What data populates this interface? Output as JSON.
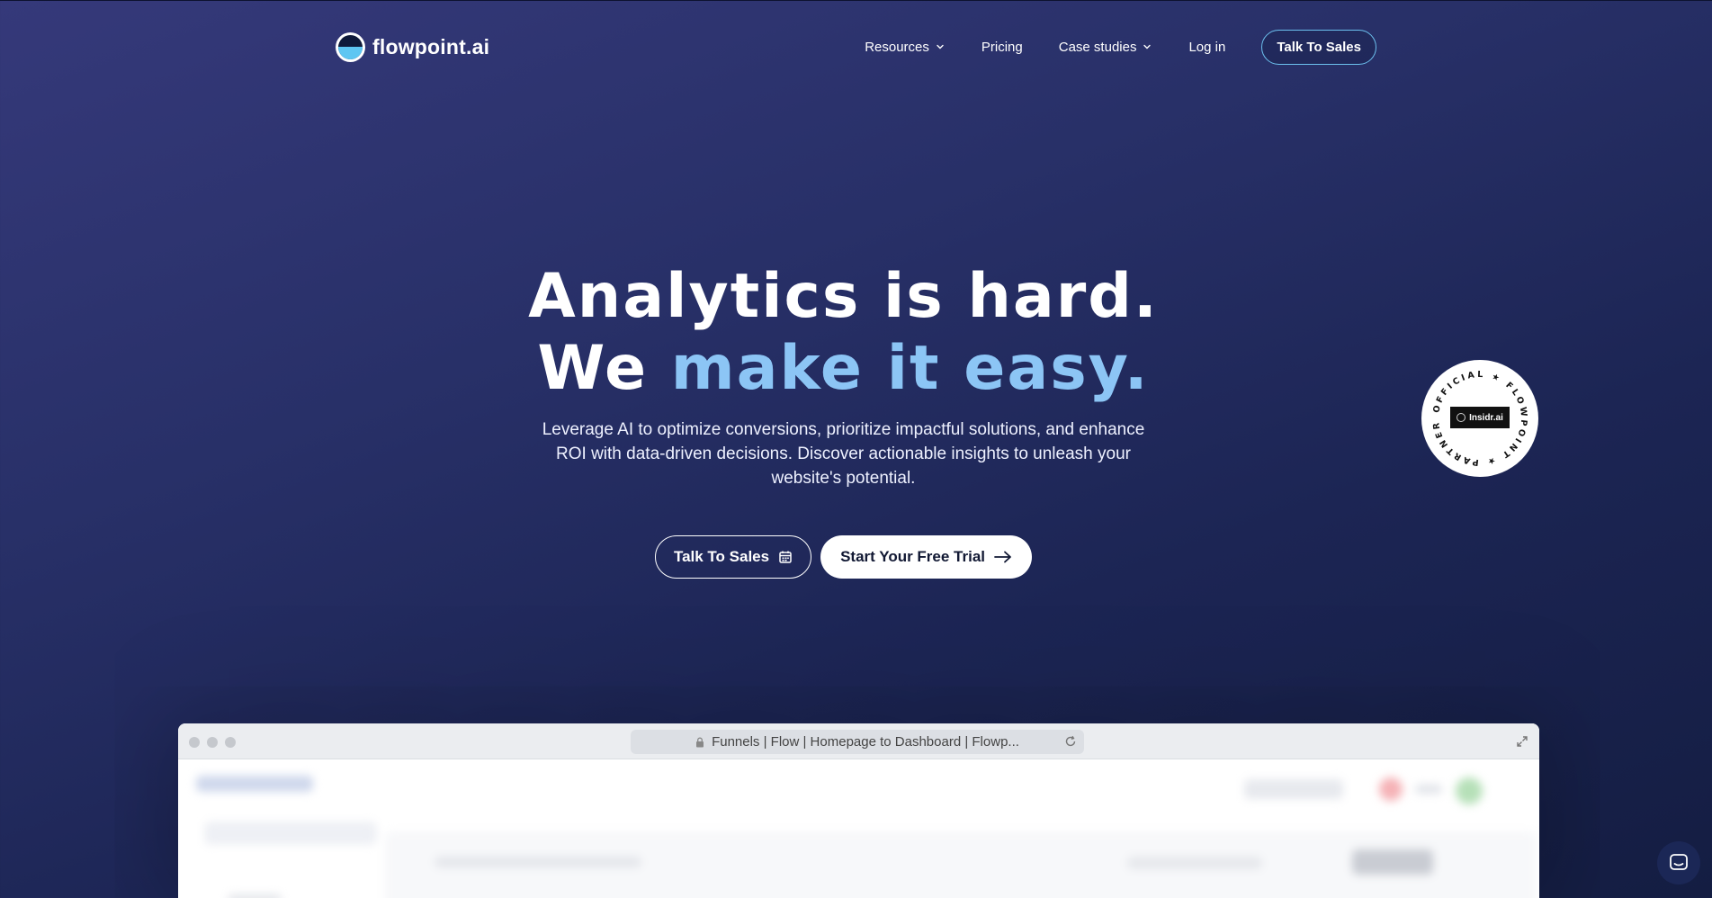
{
  "brand": {
    "name": "flowpoint.ai"
  },
  "nav": {
    "items": [
      {
        "label": "Resources",
        "dropdown": true
      },
      {
        "label": "Pricing",
        "dropdown": false
      },
      {
        "label": "Case studies",
        "dropdown": true
      },
      {
        "label": "Log in",
        "dropdown": false
      }
    ],
    "cta": "Talk To Sales"
  },
  "hero": {
    "line1": "Analytics is hard.",
    "line2_start": "We",
    "line2_accent": "make it",
    "line2_end": "easy.",
    "subtitle": "Leverage AI to optimize conversions, prioritize impactful solutions, and enhance ROI with data-driven decisions. Discover actionable insights to unleash your website's potential.",
    "cta_secondary": "Talk To Sales",
    "cta_primary": "Start Your Free Trial"
  },
  "badge": {
    "ring_text": "OFFICIAL ★ FLOWPOINT ★ PARTNER ★",
    "partner": "Insidr.ai"
  },
  "browser": {
    "tab_title": "Funnels | Flow | Homepage to Dashboard | Flowp..."
  },
  "colors": {
    "accent": "#8cc5f5",
    "nav_button_border": "#6cc0ee",
    "background_dark": "#1c2554"
  },
  "icons": [
    "logo-icon",
    "chevron-down-icon",
    "calendar-icon",
    "arrow-right-icon",
    "lock-icon",
    "reload-icon",
    "expand-icon",
    "chat-icon"
  ]
}
